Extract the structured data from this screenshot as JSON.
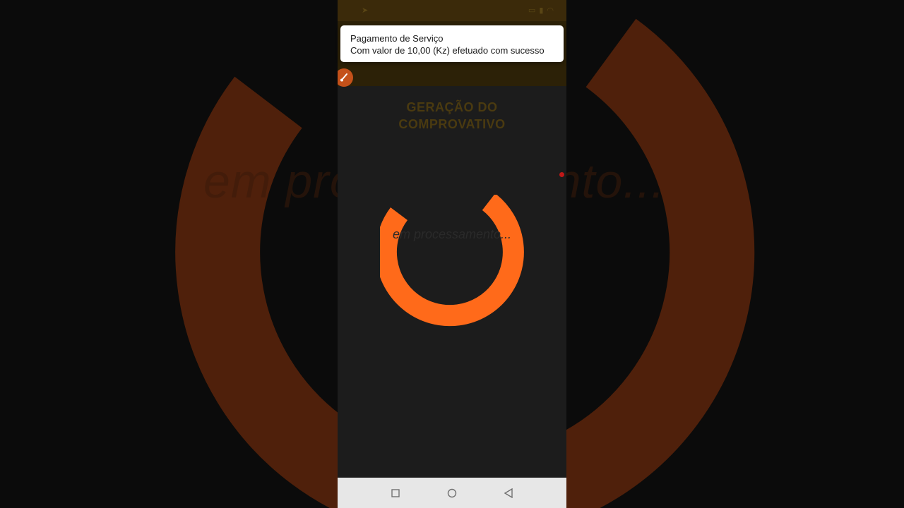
{
  "notification": {
    "title": "Pagamento de Serviço",
    "body": "Com valor de 10,00 (Kz) efetuado com sucesso"
  },
  "page": {
    "title_line1": "GERAÇÃO DO",
    "title_line2": "COMPROVATIVO",
    "processing_text": "em processamento..."
  },
  "background": {
    "processing_text": "em processamento..."
  },
  "nav": {
    "recent": "square-icon",
    "home": "circle-icon",
    "back": "triangle-back-icon"
  },
  "colors": {
    "accent": "#ff6a1a",
    "background_ring": "#4f200b",
    "toast_bg": "#ffffff",
    "nav_bg": "#e7e7e7"
  }
}
